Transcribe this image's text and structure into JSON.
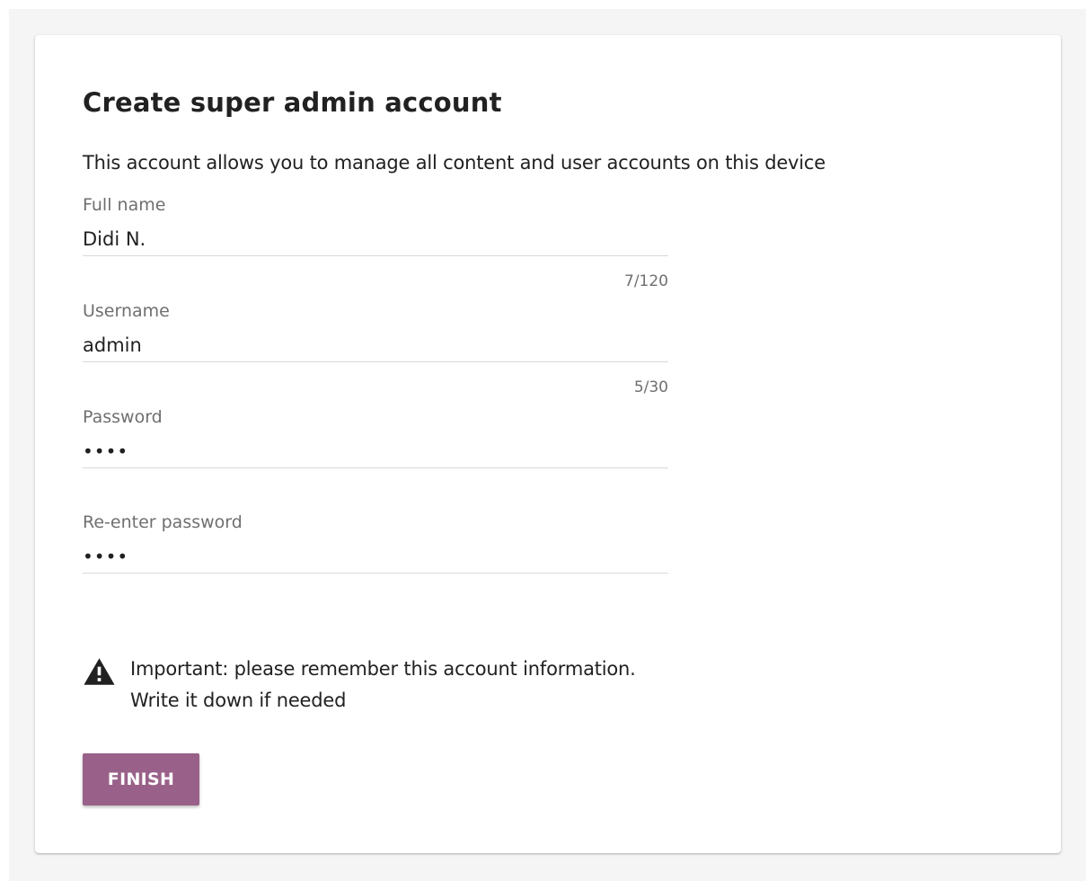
{
  "header": {
    "title": "Create super admin account",
    "description": "This account allows you to manage all content and user accounts on this device"
  },
  "form": {
    "full_name": {
      "label": "Full name",
      "value": "Didi N.",
      "counter": "7/120"
    },
    "username": {
      "label": "Username",
      "value": "admin",
      "counter": "5/30"
    },
    "password": {
      "label": "Password",
      "value": "abcd"
    },
    "reenter_password": {
      "label": "Re-enter password",
      "value": "abcd"
    }
  },
  "notice": {
    "icon": "warning-icon",
    "line1": "Important: please remember this account information.",
    "line2": "Write it down if needed"
  },
  "actions": {
    "finish_label": "FINISH"
  },
  "colors": {
    "accent": "#996189",
    "text": "#212121",
    "muted_text": "#6f6f6f",
    "background": "#f5f5f5",
    "card": "#ffffff"
  }
}
